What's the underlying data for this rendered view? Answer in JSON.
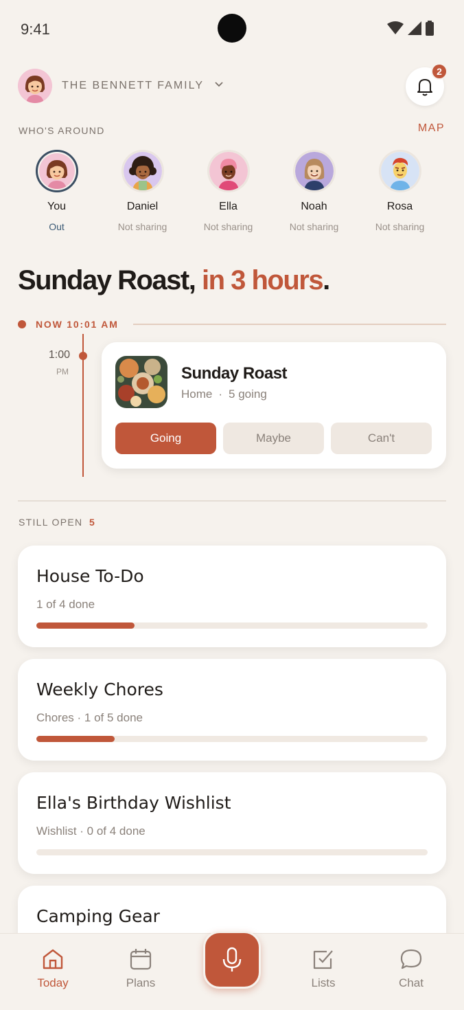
{
  "status_bar": {
    "time": "9:41"
  },
  "header": {
    "family_name": "THE BENNETT FAMILY",
    "notification_count": "2"
  },
  "whos_around": {
    "label": "WHO'S AROUND",
    "map_label": "MAP",
    "people": [
      {
        "name": "You",
        "status": "Out"
      },
      {
        "name": "Daniel",
        "status": "Not sharing"
      },
      {
        "name": "Ella",
        "status": "Not sharing"
      },
      {
        "name": "Noah",
        "status": "Not sharing"
      },
      {
        "name": "Rosa",
        "status": "Not sharing"
      }
    ]
  },
  "headline": {
    "event": "Sunday Roast,",
    "countdown": " in 3 hours",
    "period": "."
  },
  "timeline": {
    "now_label": "NOW 10:01 AM"
  },
  "event": {
    "time": "1:00",
    "ampm": "PM",
    "title": "Sunday Roast",
    "location": "Home",
    "going_count": "5 going",
    "rsvp_going": "Going",
    "rsvp_maybe": "Maybe",
    "rsvp_cant": "Can't"
  },
  "still_open": {
    "label": "STILL OPEN",
    "count": "5",
    "lists": [
      {
        "title": "House To-Do",
        "subtitle": "1 of 4 done",
        "progress": 0.25
      },
      {
        "title": "Weekly Chores",
        "subtitle": "Chores · 1 of 5 done",
        "progress": 0.2
      },
      {
        "title": "Ella's Birthday Wishlist",
        "subtitle": "Wishlist · 0 of 4 done",
        "progress": 0
      },
      {
        "title": "Camping Gear",
        "subtitle": "",
        "progress": 0
      }
    ]
  },
  "bottom_nav": {
    "items": [
      {
        "label": "Today",
        "icon": "home-icon"
      },
      {
        "label": "Plans",
        "icon": "calendar-icon"
      },
      {
        "label": "Lists",
        "icon": "checkbox-icon"
      },
      {
        "label": "Chat",
        "icon": "chat-bubble-icon"
      }
    ],
    "mic_icon": "microphone-icon"
  },
  "colors": {
    "accent": "#c0573a",
    "background": "#f6f2ed",
    "out_status": "#3b5a75"
  }
}
